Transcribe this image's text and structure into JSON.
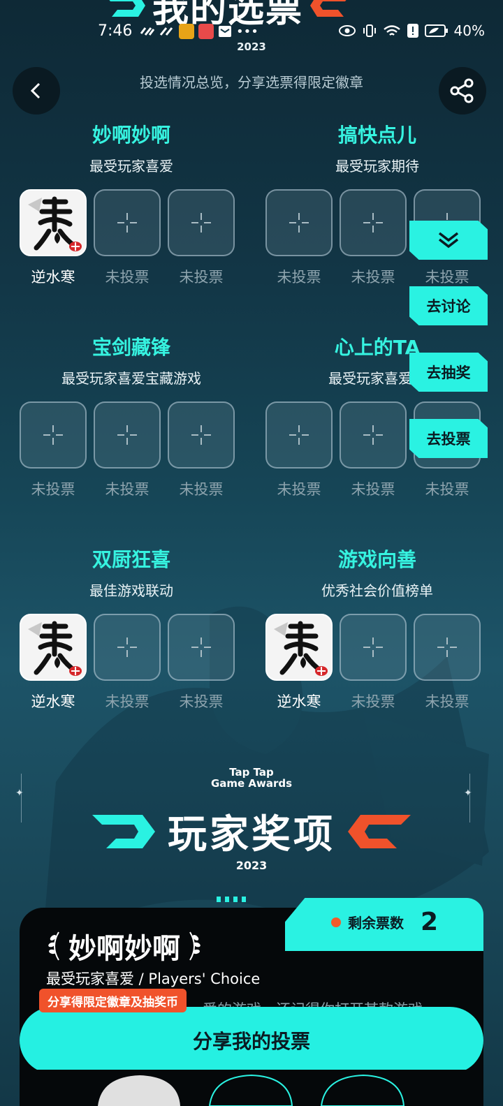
{
  "header": {
    "title": "我的选票",
    "year": "2023",
    "subtitle": "投选情况总览，分享选票得限定徽章"
  },
  "status_bar": {
    "time": "7:46",
    "battery": "40%"
  },
  "colors": {
    "accent_cyan": "#2af2e2",
    "accent_orange": "#f0522b",
    "card_bg": "#05080a"
  },
  "categories": [
    {
      "title": "妙啊妙啊",
      "subtitle": "最受玩家喜爱",
      "slots": [
        {
          "label": "逆水寒",
          "voted": true,
          "icon": "nishuihan-game-icon"
        },
        {
          "label": "未投票",
          "voted": false
        },
        {
          "label": "未投票",
          "voted": false
        }
      ]
    },
    {
      "title": "搞快点儿",
      "subtitle": "最受玩家期待",
      "slots": [
        {
          "label": "未投票",
          "voted": false
        },
        {
          "label": "未投票",
          "voted": false
        },
        {
          "label": "未投票",
          "voted": false
        }
      ]
    },
    {
      "title": "宝剑藏锋",
      "subtitle": "最受玩家喜爱宝藏游戏",
      "slots": [
        {
          "label": "未投票",
          "voted": false
        },
        {
          "label": "未投票",
          "voted": false
        },
        {
          "label": "未投票",
          "voted": false
        }
      ]
    },
    {
      "title": "心上的TA",
      "subtitle": "最受玩家喜爱角",
      "slots": [
        {
          "label": "未投票",
          "voted": false
        },
        {
          "label": "未投票",
          "voted": false
        },
        {
          "label": "未投票",
          "voted": false
        }
      ]
    },
    {
      "title": "双厨狂喜",
      "subtitle": "最佳游戏联动",
      "slots": [
        {
          "label": "逆水寒",
          "voted": true,
          "icon": "nishuihan-game-icon"
        },
        {
          "label": "未投票",
          "voted": false
        },
        {
          "label": "未投票",
          "voted": false
        }
      ]
    },
    {
      "title": "游戏向善",
      "subtitle": "优秀社会价值榜单",
      "slots": [
        {
          "label": "逆水寒",
          "voted": true,
          "icon": "nishuihan-game-icon"
        },
        {
          "label": "未投票",
          "voted": false
        },
        {
          "label": "未投票",
          "voted": false
        }
      ]
    }
  ],
  "float_buttons": {
    "discuss": "去讨论",
    "lottery": "去抽奖",
    "vote": "去投票"
  },
  "awards": {
    "brand_line1": "Tap Tap",
    "brand_line2": "Game Awards",
    "title": "玩家奖项",
    "year": "2023"
  },
  "card": {
    "votes_label": "剩余票数",
    "votes_count": "2",
    "category": "妙啊妙啊",
    "subtitle": "最受玩家喜爱 / Players' Choice",
    "desc_fragment": "爱的游戏，还记得你打开某款游戏",
    "share_badge": "分享得限定徽章及抽奖币",
    "share_button": "分享我的投票"
  }
}
